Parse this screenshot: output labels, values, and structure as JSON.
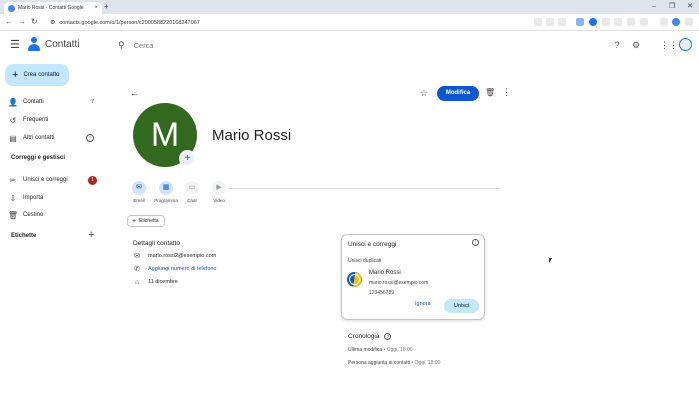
{
  "browser": {
    "tab_title": "Mario Rossi - Contatti Google",
    "tab_close": "×",
    "new_tab": "+",
    "url": "contacts.google.com/u/1/person/c2900588220168247067"
  },
  "app": {
    "name": "Contatti",
    "search_placeholder": "Cerca"
  },
  "sidebar": {
    "create_label": "Crea contatto",
    "items": [
      {
        "label": "Contatti",
        "count": "7"
      },
      {
        "label": "Frequenti"
      },
      {
        "label": "Altri contatti"
      }
    ],
    "fix_section": "Correggi e gestisci",
    "fix_items": [
      {
        "label": "Unisci e correggi",
        "badge": "1"
      },
      {
        "label": "Importa"
      },
      {
        "label": "Cestino"
      }
    ],
    "labels_section": "Etichette"
  },
  "contact": {
    "initial": "M",
    "name": "Mario Rossi",
    "edit_label": "Modifica",
    "actions": [
      {
        "label": "Email"
      },
      {
        "label": "Programma"
      },
      {
        "label": "Chat"
      },
      {
        "label": "Video"
      }
    ],
    "label_chip": "Etichetta",
    "details_title": "Dettagli contatto",
    "email": "mario.rossi2@esempio.com",
    "add_phone": "Aggiungi numero di telefono",
    "birthday": "11 dicembre"
  },
  "suggestion": {
    "title": "Unisci e correggi",
    "subtitle": "Unisci duplicati",
    "dup_name": "Mario Rossi",
    "dup_email": "mario.rossi@esempio.com",
    "dup_phone": "123456789",
    "ignore_label": "Ignora",
    "merge_label": "Unisci"
  },
  "history": {
    "title": "Cronologia",
    "rows": [
      {
        "label": "Ultima modifica",
        "time": " • Oggi, 18:00"
      },
      {
        "label": "Persona aggiunta ai contatti",
        "time": " • Oggi, 18:00"
      }
    ]
  },
  "colors": {
    "accent": "#0b57d0",
    "avatar": "#33691e",
    "create_bg": "#c2e7ff"
  }
}
